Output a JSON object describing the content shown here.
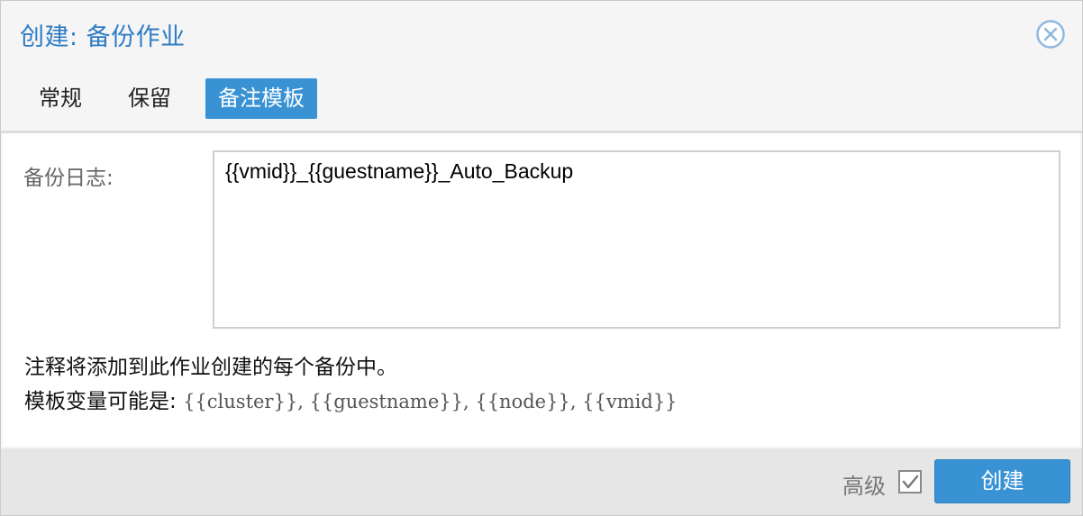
{
  "dialog": {
    "title": "创建: 备份作业"
  },
  "tabs": [
    {
      "label": "常规",
      "active": false
    },
    {
      "label": "保留",
      "active": false
    },
    {
      "label": "备注模板",
      "active": true
    }
  ],
  "notes": {
    "label": "备份日志:",
    "value": "{{vmid}}_{{guestname}}_Auto_Backup"
  },
  "help": {
    "line1": "注释将添加到此作业创建的每个备份中。",
    "line2_prefix": "模板变量可能是:",
    "line2_vars": "{{cluster}}, {{guestname}}, {{node}}, {{vmid}}"
  },
  "footer": {
    "advanced_label": "高级",
    "advanced_checked": true,
    "create_label": "创建"
  },
  "colors": {
    "accent": "#3892d4",
    "title": "#2e7bc4",
    "footer_bg": "#e6e6e6"
  },
  "icons": {
    "close": "close-circle-icon",
    "checkbox": "checkbox-checked-icon"
  }
}
